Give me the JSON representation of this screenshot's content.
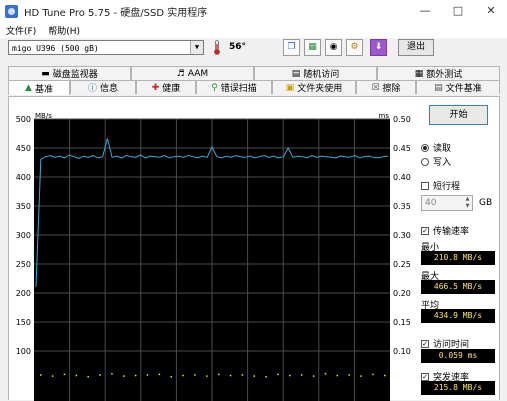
{
  "window": {
    "title": "HD Tune Pro 5.75 - 硬盘/SSD 实用程序"
  },
  "menu": [
    "文件(F)",
    "帮助(H)"
  ],
  "toolbar": {
    "drive": "migo    U396 (500 gB)",
    "temperature": "56°",
    "exit_label": "退出"
  },
  "tabs_top": [
    {
      "label": "磁盘监视器",
      "icon": "monitor-icon"
    },
    {
      "label": "AAM",
      "icon": "speaker-icon"
    },
    {
      "label": "随机访问",
      "icon": "random-access-icon"
    },
    {
      "label": "额外测试",
      "icon": "extra-tests-icon"
    }
  ],
  "tabs_bottom": [
    {
      "label": "基准",
      "icon": "benchmark-icon",
      "active": true
    },
    {
      "label": "信息",
      "icon": "info-icon"
    },
    {
      "label": "健康",
      "icon": "health-icon"
    },
    {
      "label": "错误扫描",
      "icon": "error-scan-icon"
    },
    {
      "label": "文件夹使用",
      "icon": "folder-icon"
    },
    {
      "label": "擦除",
      "icon": "erase-icon"
    },
    {
      "label": "文件基准",
      "icon": "file-benchmark-icon"
    }
  ],
  "chart_data": {
    "type": "line",
    "left_unit": "MB/s",
    "right_unit": "ms",
    "left_ticks": [
      500,
      450,
      400,
      350,
      300,
      250,
      200,
      150,
      100
    ],
    "right_ticks": [
      0.5,
      0.45,
      0.4,
      0.35,
      0.3,
      0.25,
      0.2,
      0.15,
      0.1
    ],
    "ylim_left": [
      0,
      500
    ],
    "ylim_right": [
      0,
      0.5
    ],
    "grid": true,
    "background": "#000000",
    "transfer_color": "#3fa9d6",
    "access_color": "#e6e600",
    "transfer_rate_mb_s": [
      210.8,
      430,
      435,
      437,
      434,
      436,
      433,
      438,
      435,
      432,
      436,
      434,
      437,
      433,
      435,
      466.5,
      434,
      436,
      433,
      437,
      435,
      434,
      438,
      433,
      436,
      435,
      434,
      437,
      433,
      435,
      436,
      434,
      437,
      435,
      433,
      436,
      434,
      452,
      435,
      433,
      436,
      434,
      437,
      435,
      434,
      436,
      433,
      435,
      437,
      434,
      436,
      433,
      435,
      450,
      434,
      436,
      435,
      433,
      437,
      434,
      436,
      435,
      434,
      433,
      436,
      435,
      434,
      437,
      433,
      435,
      436,
      434,
      433,
      435,
      436
    ],
    "access_time_ms": [
      0.06,
      0.058,
      0.061,
      0.059,
      0.057,
      0.06,
      0.062,
      0.058,
      0.059,
      0.06,
      0.061,
      0.057,
      0.059,
      0.06,
      0.058,
      0.061,
      0.059,
      0.06,
      0.058,
      0.057,
      0.061,
      0.059,
      0.06,
      0.058,
      0.062,
      0.059,
      0.06,
      0.058,
      0.061,
      0.059
    ]
  },
  "side": {
    "start_label": "开始",
    "read_label": "读取",
    "write_label": "写入",
    "short_stroke_label": "短行程",
    "short_stroke_value": "40",
    "unit": "GB",
    "transfer_label": "传输速率",
    "min_label": "最小",
    "min_value": "210.8 MB/s",
    "max_label": "最大",
    "max_value": "466.5 MB/s",
    "avg_label": "平均",
    "avg_value": "434.9 MB/s",
    "access_label": "访问时间",
    "access_value": "0.059 ms",
    "burst_label": "突发速率",
    "burst_value": "215.8 MB/s"
  }
}
